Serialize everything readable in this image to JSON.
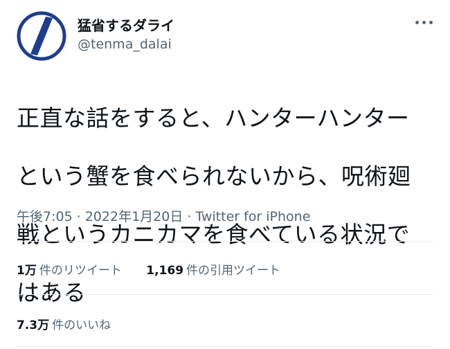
{
  "author": {
    "display_name": "猛省するダライ",
    "handle": "@tenma_dalai",
    "avatar_icon": "slash-circle-avatar-icon",
    "avatar_colors": {
      "ring": "#1d3d8f",
      "fill": "#ffffff"
    }
  },
  "more_icon": "more-horizontal-icon",
  "tweet": {
    "lines": [
      "正直な話をすると、ハンターハンター",
      "という蟹を食べられないから、呪術廻",
      "戦というカニカマを食べている状況で",
      "はある"
    ]
  },
  "meta": {
    "time": "午後7:05",
    "separator": "·",
    "date": "2022年1月20日",
    "source": "Twitter for iPhone"
  },
  "stats": {
    "retweets": {
      "count": "1万",
      "label": "件のリツイート"
    },
    "quotes": {
      "count": "1,169",
      "label": "件の引用ツイート"
    },
    "likes": {
      "count": "7.3万",
      "label": "件のいいね"
    }
  }
}
